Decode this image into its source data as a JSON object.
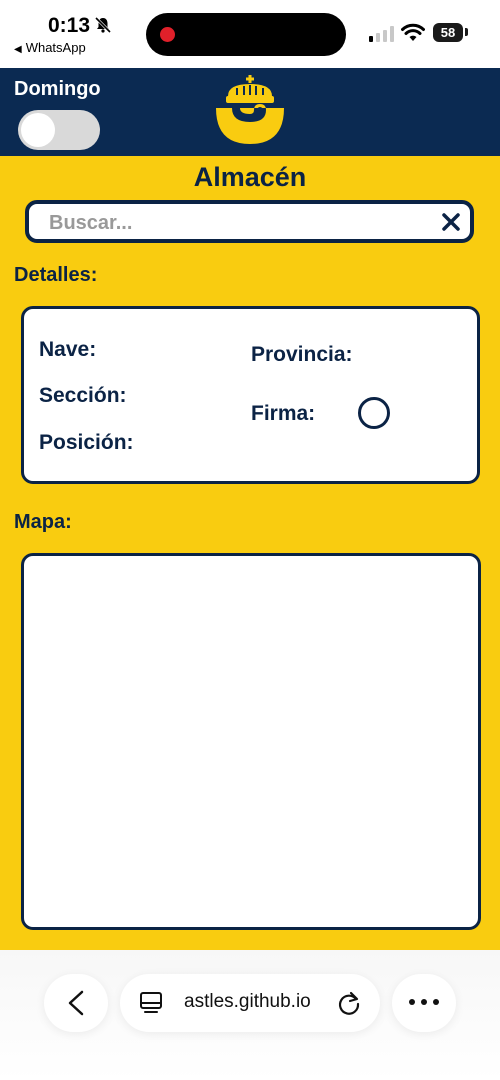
{
  "status_bar": {
    "time": "0:13",
    "back_app": "WhatsApp",
    "battery": "58"
  },
  "header": {
    "domingo_label": "Domingo",
    "domingo_toggle_on": false
  },
  "main": {
    "title": "Almacén",
    "search": {
      "placeholder": "Buscar...",
      "value": ""
    },
    "details": {
      "label": "Detalles:",
      "nave": "Nave:",
      "seccion": "Sección:",
      "posicion": "Posición:",
      "provincia": "Provincia:",
      "firma": "Firma:"
    },
    "map": {
      "label": "Mapa:"
    }
  },
  "browser": {
    "url": "astles.github.io"
  },
  "colors": {
    "brand_yellow": "#f9cc10",
    "brand_navy": "#0b2a52",
    "text_navy": "#0b2345"
  },
  "icons": [
    "bell-slash-icon",
    "signal-icon",
    "wifi-icon",
    "correos-logo",
    "close-icon",
    "chevron-left-icon",
    "tabs-icon",
    "reload-icon",
    "more-icon"
  ]
}
